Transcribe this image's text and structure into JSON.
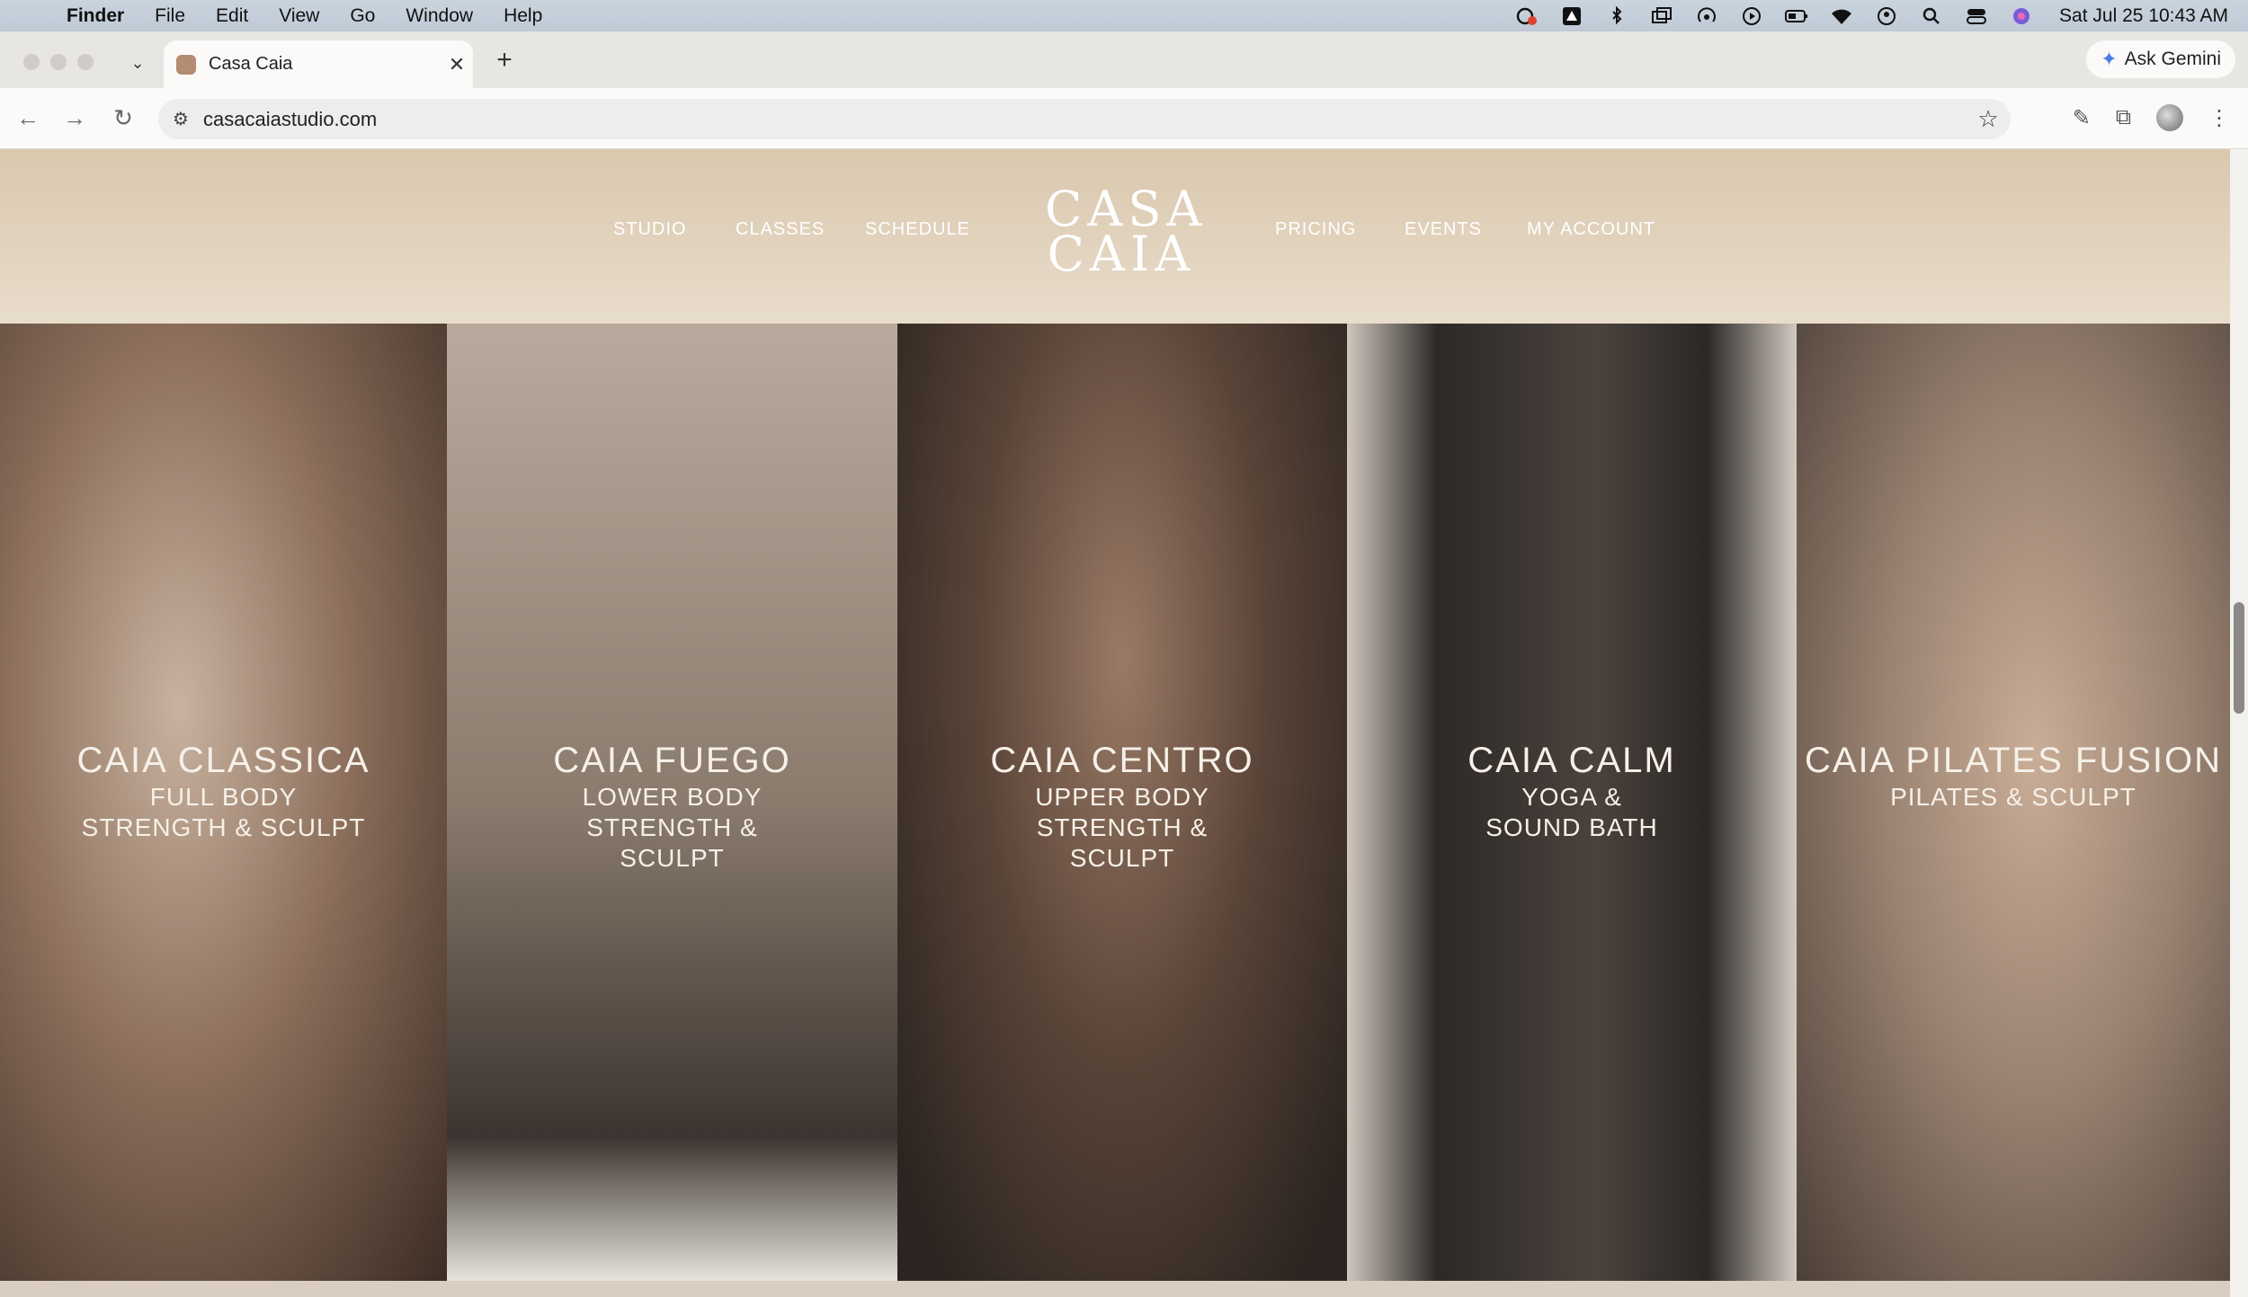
{
  "menubar": {
    "app": "Finder",
    "items": [
      "File",
      "Edit",
      "View",
      "Go",
      "Window",
      "Help"
    ],
    "clock": "Sat Jul 25  10:43 AM"
  },
  "browser": {
    "tab_title": "Casa Caia",
    "gemini_label": "Ask Gemini",
    "url": "casacaiastudio.com"
  },
  "site": {
    "logo_line1": "CASA",
    "logo_line2": "CAIA",
    "nav_left": [
      "STUDIO",
      "CLASSES",
      "SCHEDULE"
    ],
    "nav_right": [
      "PRICING",
      "EVENTS",
      "MY ACCOUNT"
    ]
  },
  "classes": [
    {
      "name": "CAIA CLASSICA",
      "sub": "FULL BODY\nSTRENGTH & SCULPT",
      "color": "#6b5546"
    },
    {
      "name": "CAIA FUEGO",
      "sub": "LOWER BODY\nSTRENGTH &\nSCULPT",
      "color": "#8a7b6d"
    },
    {
      "name": "CAIA CENTRO",
      "sub": "UPPER BODY\nSTRENGTH &\nSCULPT",
      "color": "#5a4438"
    },
    {
      "name": "CAIA CALM",
      "sub": "YOGA &\nSOUND BATH",
      "color": "#4a423d"
    },
    {
      "name": "CAIA PILATES FUSION",
      "sub": "PILATES & SCULPT",
      "color": "#9a8372"
    }
  ]
}
